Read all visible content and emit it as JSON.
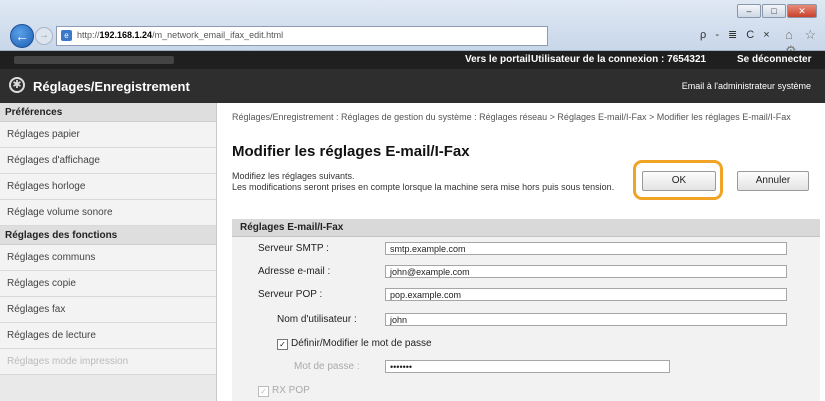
{
  "browser": {
    "url_prefix": "http://",
    "url_host": "192.168.1.24",
    "url_path": "/m_network_email_ifax_edit.html",
    "search_glyph": "ρ - ≣ C ×",
    "toolbar_glyphs": "⌂ ☆ ⚙"
  },
  "header": {
    "portal_link": "Vers le portail",
    "user_label": "Utilisateur de la connexion : 7654321",
    "logout_link": "Se déconnecter",
    "title": "Réglages/Enregistrement",
    "email_admin_link": "Email à l'administrateur système"
  },
  "sidebar": {
    "section1": "Préférences",
    "items1": [
      "Réglages papier",
      "Réglages d'affichage",
      "Réglages horloge",
      "Réglage volume sonore"
    ],
    "section2": "Réglages des fonctions",
    "items2": [
      "Réglages communs",
      "Réglages copie",
      "Réglages fax",
      "Réglages de lecture",
      "Réglages mode impression"
    ]
  },
  "main": {
    "breadcrumb": "Réglages/Enregistrement : Réglages de gestion du système : Réglages réseau > Réglages E-mail/I-Fax > Modifier les réglages E-mail/I-Fax",
    "title": "Modifier les réglages E-mail/I-Fax",
    "description_line1": "Modifiez les réglages suivants.",
    "description_line2": "Les modifications seront prises en compte lorsque la machine sera mise hors puis sous tension.",
    "ok_label": "OK",
    "cancel_label": "Annuler",
    "section_title": "Réglages E-mail/I-Fax",
    "smtp_label": "Serveur SMTP :",
    "smtp_value": "smtp.example.com",
    "email_label": "Adresse e-mail :",
    "email_value": "john@example.com",
    "pop_label": "Serveur POP :",
    "pop_value": "pop.example.com",
    "username_label": "Nom d'utilisateur :",
    "username_value": "john",
    "set_password_label": "Définir/Modifier le mot de passe",
    "password_label": "Mot de passe :",
    "password_value": "•••••••",
    "rx_pop_label": "RX POP"
  },
  "colors": {
    "highlight": "#f0a324",
    "title_bar": "#2e2e2e",
    "top_bar": "#1f1f1f"
  }
}
